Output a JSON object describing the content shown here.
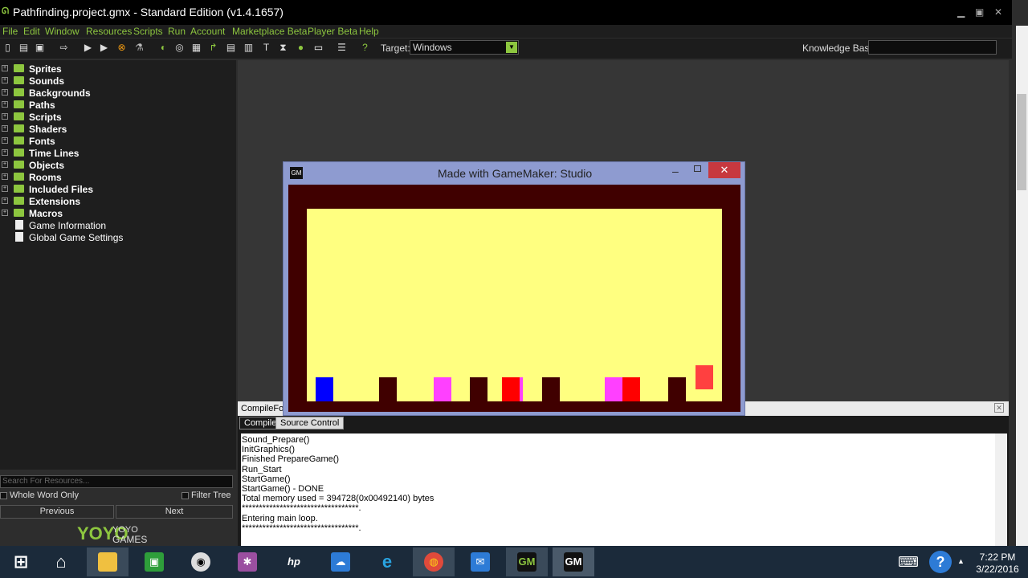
{
  "window": {
    "title": "Pathfinding.project.gmx  -  Standard Edition (v1.4.1657)"
  },
  "menu": [
    "File",
    "Edit",
    "Window",
    "Resources",
    "Scripts",
    "Run",
    "Account",
    "Marketplace Beta",
    "Player Beta",
    "Help"
  ],
  "toolbar": {
    "target_label": "Target:",
    "target_value": "Windows",
    "knowledge_label": "Knowledge Base:"
  },
  "tree": [
    {
      "label": "Sprites",
      "folder": true
    },
    {
      "label": "Sounds",
      "folder": true
    },
    {
      "label": "Backgrounds",
      "folder": true
    },
    {
      "label": "Paths",
      "folder": true
    },
    {
      "label": "Scripts",
      "folder": true
    },
    {
      "label": "Shaders",
      "folder": true
    },
    {
      "label": "Fonts",
      "folder": true
    },
    {
      "label": "Time Lines",
      "folder": true
    },
    {
      "label": "Objects",
      "folder": true
    },
    {
      "label": "Rooms",
      "folder": true
    },
    {
      "label": "Included Files",
      "folder": true
    },
    {
      "label": "Extensions",
      "folder": true
    },
    {
      "label": "Macros",
      "folder": true
    },
    {
      "label": "Game Information",
      "folder": false
    },
    {
      "label": "Global Game Settings",
      "folder": false
    }
  ],
  "search": {
    "placeholder": "Search For Resources..."
  },
  "options": {
    "whole_word": "Whole Word Only",
    "filter_tree": "Filter Tree"
  },
  "nav": {
    "previous": "Previous",
    "next": "Next"
  },
  "brand": {
    "line1": "YOYO",
    "line2": "GAMES"
  },
  "compile": {
    "header": "CompileForm",
    "tabs": [
      "Compile",
      "Source Control"
    ],
    "log": [
      "Sound_Prepare()",
      "InitGraphics()",
      "Finished PrepareGame()",
      "Run_Start",
      "StartGame()",
      "StartGame() - DONE",
      "Total memory used = 394728(0x00492140) bytes",
      "**********************************.",
      "Entering main loop.",
      "**********************************."
    ]
  },
  "game_window": {
    "title": "Made with GameMaker: Studio"
  },
  "taskbar": {
    "time": "7:22 PM",
    "date": "3/22/2016"
  },
  "colors": {
    "accent": "#8dc63f",
    "room": "#ffff80",
    "border": "#400000"
  }
}
